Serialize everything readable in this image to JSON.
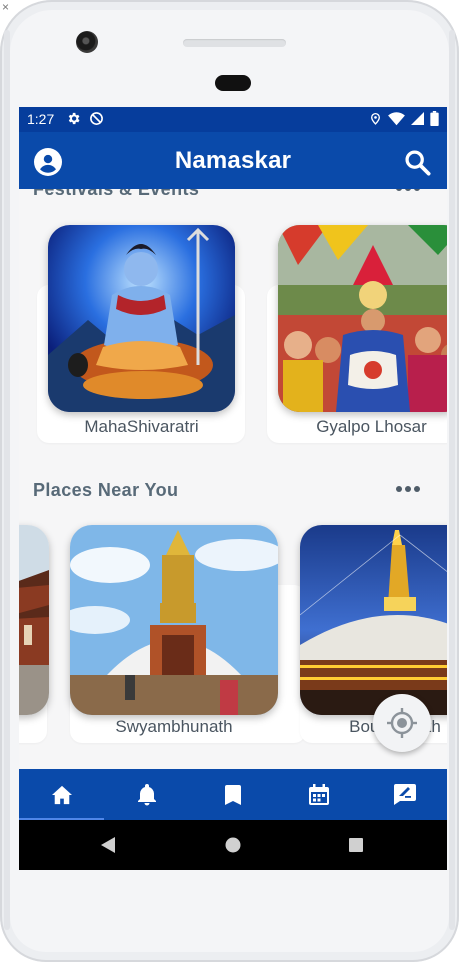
{
  "window": {
    "close_glyph": "×"
  },
  "status_bar": {
    "time": "1:27",
    "left_icons": [
      "gear-icon",
      "no-disturb-icon"
    ],
    "right_icons": [
      "location-icon",
      "wifi-icon",
      "signal-icon",
      "battery-icon"
    ]
  },
  "app_bar": {
    "title": "Namaskar",
    "left_icon": "account-icon",
    "right_icon": "search-icon"
  },
  "sections": [
    {
      "title": "Festivals & Events",
      "more_icon": "more-horizontal-icon",
      "cards": [
        {
          "label": "MahaShivaratri",
          "image": "shiva-image"
        },
        {
          "label": "Gyalpo Lhosar",
          "image": "lhosar-dance-image"
        }
      ]
    },
    {
      "title": "Places Near You",
      "more_icon": "more-horizontal-icon",
      "cards": [
        {
          "label": "",
          "image": "durbar-square-image"
        },
        {
          "label": "Swyambhunath",
          "image": "swyambhunath-stupa-image"
        },
        {
          "label": "Boudhanath",
          "image": "boudhanath-stupa-image"
        }
      ]
    }
  ],
  "fab": {
    "icon": "my-location-icon"
  },
  "bottom_nav": {
    "items": [
      {
        "name": "home",
        "icon": "home-icon",
        "active": true
      },
      {
        "name": "notifications",
        "icon": "bell-icon",
        "active": false
      },
      {
        "name": "bookmarks",
        "icon": "bookmark-icon",
        "active": false
      },
      {
        "name": "calendar",
        "icon": "calendar-icon",
        "active": false
      },
      {
        "name": "feedback",
        "icon": "feedback-icon",
        "active": false
      }
    ]
  },
  "colors": {
    "status_bar": "#063d9c",
    "app_bar": "#0a4aaa",
    "active_indicator": "#4f86e8",
    "section_title": "#586a78",
    "card_label": "#4a5560",
    "background": "#f6f6f7"
  }
}
